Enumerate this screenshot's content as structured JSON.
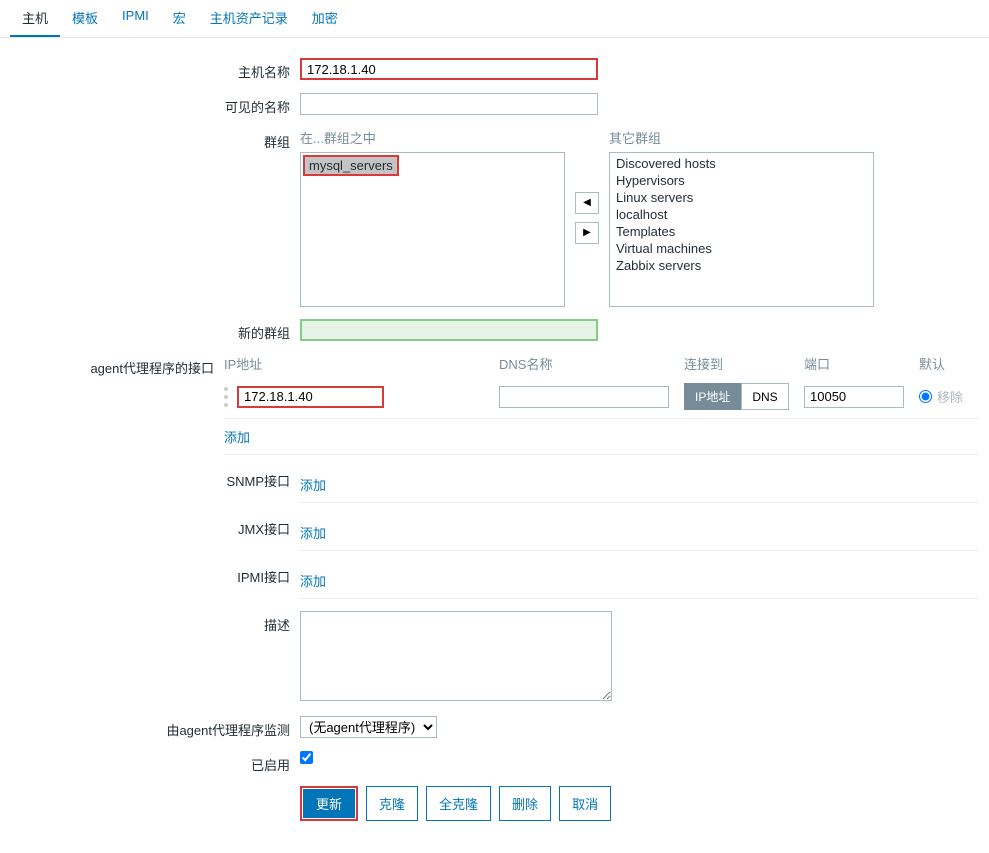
{
  "tabs": {
    "host": "主机",
    "template": "模板",
    "ipmi": "IPMI",
    "macro": "宏",
    "inventory": "主机资产记录",
    "encryption": "加密"
  },
  "labels": {
    "hostname": "主机名称",
    "visible_name": "可见的名称",
    "groups": "群组",
    "in_groups": "在...群组之中",
    "other_groups": "其它群组",
    "new_group": "新的群组",
    "agent_interface": "agent代理程序的接口",
    "ip_address": "IP地址",
    "dns_name": "DNS名称",
    "connect_to": "连接到",
    "port": "端口",
    "default": "默认",
    "remove": "移除",
    "add": "添加",
    "snmp_interface": "SNMP接口",
    "jmx_interface": "JMX接口",
    "ipmi_interface": "IPMI接口",
    "description": "描述",
    "monitored_by": "由agent代理程序监测",
    "enabled": "已启用"
  },
  "values": {
    "hostname": "172.18.1.40",
    "visible_name": "",
    "selected_group": "mysql_servers",
    "new_group": "",
    "agent_ip": "172.18.1.40",
    "agent_dns": "",
    "agent_port": "10050",
    "description": "",
    "proxy_selected": "(无agent代理程序)",
    "enabled_checked": true
  },
  "other_groups": [
    "Discovered hosts",
    "Hypervisors",
    "Linux servers",
    "localhost",
    "Templates",
    "Virtual machines",
    "Zabbix servers"
  ],
  "toggles": {
    "ip": "IP地址",
    "dns": "DNS"
  },
  "buttons": {
    "update": "更新",
    "clone": "克隆",
    "full_clone": "全克隆",
    "delete": "删除",
    "cancel": "取消"
  }
}
